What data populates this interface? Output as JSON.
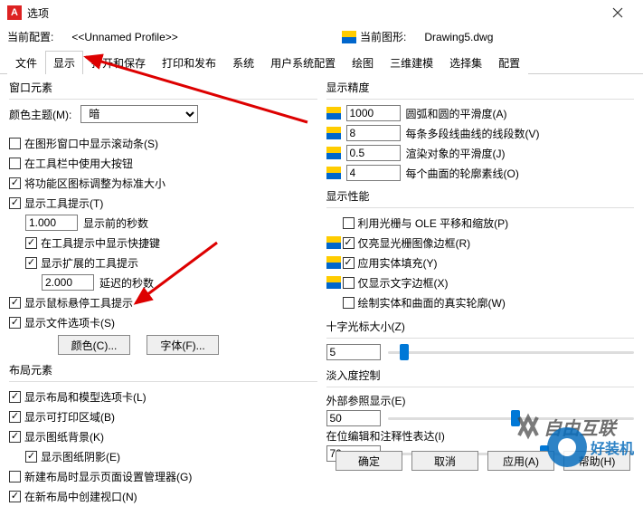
{
  "window": {
    "title": "选项"
  },
  "profile": {
    "current_label": "当前配置:",
    "current_value": "<<Unnamed Profile>>",
    "drawing_label": "当前图形:",
    "drawing_value": "Drawing5.dwg"
  },
  "tabs": [
    "文件",
    "显示",
    "打开和保存",
    "打印和发布",
    "系统",
    "用户系统配置",
    "绘图",
    "三维建模",
    "选择集",
    "配置"
  ],
  "active_tab": 1,
  "left": {
    "window_elements": {
      "title": "窗口元素",
      "color_theme_label": "颜色主题(M):",
      "color_theme_value": "暗",
      "show_scrollbars": "在图形窗口中显示滚动条(S)",
      "use_large_buttons": "在工具栏中使用大按钮",
      "resize_ribbon": "将功能区图标调整为标准大小",
      "show_tooltips": "显示工具提示(T)",
      "seconds_value": "1.000",
      "seconds_label": "显示前的秒数",
      "show_shortcuts": "在工具提示中显示快捷键",
      "show_extended": "显示扩展的工具提示",
      "delay_value": "2.000",
      "delay_label": "延迟的秒数",
      "show_rollover": "显示鼠标悬停工具提示",
      "show_file_tabs": "显示文件选项卡(S)",
      "colors_btn": "颜色(C)...",
      "fonts_btn": "字体(F)..."
    },
    "layout_elements": {
      "title": "布局元素",
      "show_layout_tabs": "显示布局和模型选项卡(L)",
      "show_printable": "显示可打印区域(B)",
      "show_paper_bg": "显示图纸背景(K)",
      "show_paper_shadow": "显示图纸阴影(E)",
      "new_layout_pagesetup": "新建布局时显示页面设置管理器(G)",
      "create_viewport": "在新布局中创建视口(N)"
    }
  },
  "right": {
    "precision": {
      "title": "显示精度",
      "arc_value": "1000",
      "arc_label": "圆弧和圆的平滑度(A)",
      "seg_value": "8",
      "seg_label": "每条多段线曲线的线段数(V)",
      "render_value": "0.5",
      "render_label": "渲染对象的平滑度(J)",
      "surface_value": "4",
      "surface_label": "每个曲面的轮廓素线(O)"
    },
    "performance": {
      "title": "显示性能",
      "pan_zoom": "利用光栅与 OLE 平移和缩放(P)",
      "highlight_frame": "仅亮显光栅图像边框(R)",
      "solid_fill": "应用实体填充(Y)",
      "text_frame": "仅显示文字边框(X)",
      "true_silhouette": "绘制实体和曲面的真实轮廓(W)"
    },
    "crosshair": {
      "title": "十字光标大小(Z)",
      "value": "5"
    },
    "fade": {
      "title": "淡入度控制",
      "xref_label": "外部参照显示(E)",
      "xref_value": "50",
      "inplace_label": "在位编辑和注释性表达(I)",
      "inplace_value": "70"
    }
  },
  "footer": {
    "ok": "确定",
    "cancel": "取消",
    "apply": "应用(A)",
    "help": "帮助(H)"
  },
  "watermark": "自由互联",
  "watermark2": "好装机"
}
